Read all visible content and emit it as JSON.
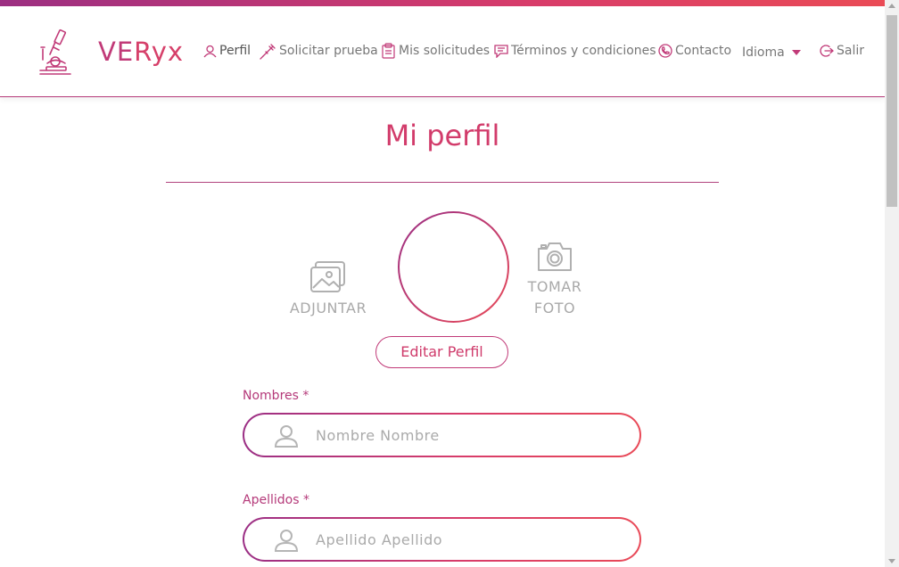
{
  "brand": {
    "name_prefix": "VE",
    "name_suffix": "Ryx"
  },
  "nav": {
    "perfil": "Perfil",
    "solicitar": "Solicitar prueba",
    "solicitudes": "Mis solicitudes",
    "terminos": "Términos y condiciones",
    "contacto": "Contacto",
    "idioma": "Idioma",
    "salir": "Salir"
  },
  "page": {
    "title": "Mi perfil"
  },
  "photo": {
    "attach_label": "ADJUNTAR",
    "camera_line1": "TOMAR",
    "camera_line2": "FOTO"
  },
  "edit_button": "Editar Perfil",
  "form": {
    "nombres": {
      "label": "Nombres *",
      "value": "Nombre Nombre"
    },
    "apellidos": {
      "label": "Apellidos *",
      "value": "Apellido Apellido"
    }
  },
  "colors": {
    "accent": "#c13a78",
    "accent_end": "#e94a58",
    "muted": "#a9a9a9"
  },
  "icons": [
    "microscope-icon",
    "user-icon",
    "syringe-icon",
    "clipboard-icon",
    "message-icon",
    "phone-icon",
    "logout-icon",
    "image-icon",
    "camera-icon"
  ]
}
